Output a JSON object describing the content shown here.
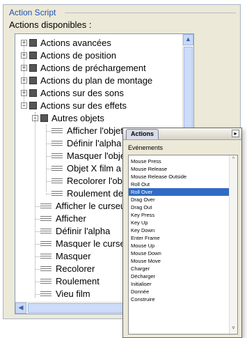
{
  "panel": {
    "group_title": "Action Script",
    "available_label": "Actions disponibles :"
  },
  "tree": {
    "items": [
      {
        "label": "Actions avancées",
        "level": 0,
        "expander": "+",
        "icon": "book-icon"
      },
      {
        "label": "Actions de position",
        "level": 0,
        "expander": "+",
        "icon": "book-icon"
      },
      {
        "label": "Actions de préchargement",
        "level": 0,
        "expander": "+",
        "icon": "book-icon"
      },
      {
        "label": "Actions du plan de montage",
        "level": 0,
        "expander": "+",
        "icon": "book-icon"
      },
      {
        "label": "Actions sur des  sons",
        "level": 0,
        "expander": "+",
        "icon": "book-icon"
      },
      {
        "label": "Actions sur des effets",
        "level": 0,
        "expander": "-",
        "icon": "book-icon"
      },
      {
        "label": "Autres objets",
        "level": 1,
        "expander": "-",
        "icon": "book-icon"
      },
      {
        "label": "Afficher l'objet X",
        "level": 2,
        "icon": "action-icon"
      },
      {
        "label": "Définir l'alpha",
        "level": 2,
        "icon": "action-icon"
      },
      {
        "label": "Masquer l'obje",
        "level": 2,
        "icon": "action-icon"
      },
      {
        "label": "Objet X film a",
        "level": 2,
        "icon": "action-icon"
      },
      {
        "label": "Recolorer l'ob",
        "level": 2,
        "icon": "action-icon"
      },
      {
        "label": "Roulement de",
        "level": 2,
        "icon": "action-icon"
      },
      {
        "label": "Afficher le curseu",
        "level": 1,
        "icon": "action-icon"
      },
      {
        "label": "Afficher",
        "level": 1,
        "icon": "action-icon"
      },
      {
        "label": "Définir l'alpha",
        "level": 1,
        "icon": "action-icon"
      },
      {
        "label": "Masquer le curseu",
        "level": 1,
        "icon": "action-icon"
      },
      {
        "label": "Masquer",
        "level": 1,
        "icon": "action-icon"
      },
      {
        "label": "Recolorer",
        "level": 1,
        "icon": "action-icon"
      },
      {
        "label": "Roulement",
        "level": 1,
        "icon": "action-icon"
      },
      {
        "label": "Vieu film",
        "level": 1,
        "icon": "action-icon"
      }
    ]
  },
  "popup": {
    "tab_label": "Actions",
    "events_label": "Evénements",
    "selected_index": 4,
    "events": [
      "Mouse Press",
      "Mouse Release",
      "Mouse Release Outside",
      "Roll Out",
      "Roll Over",
      "Drag Over",
      "Drag Out",
      "Key Press",
      "Key Up",
      "Key Down",
      "Enter Frame",
      "Mouse Up",
      "Mouse Down",
      "Mouse Move",
      "Charger",
      "Décharger",
      "Initialiser",
      "Donnée",
      "Construire"
    ]
  },
  "colors": {
    "selection": "#316ac5",
    "group_title": "#2050b8"
  }
}
